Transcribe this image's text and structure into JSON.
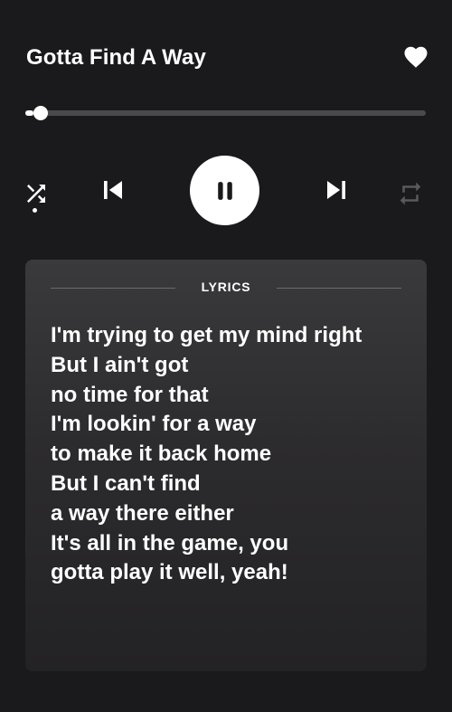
{
  "player": {
    "song_title": "Gotta Find A Way",
    "liked": true,
    "progress_fraction": 0.02,
    "shuffle_on": true,
    "repeat_on": false,
    "state": "playing"
  },
  "icons": {
    "like": "heart-icon",
    "shuffle": "shuffle-icon",
    "previous": "skip-previous-icon",
    "play_pause": "pause-icon",
    "next": "skip-next-icon",
    "repeat": "repeat-icon"
  },
  "colors": {
    "background": "#1a191b",
    "foreground": "#ffffff",
    "inactive": "#4a494c"
  },
  "lyrics": {
    "label": "LYRICS",
    "lines": [
      "I'm trying to get my mind right",
      "But I ain't got",
      "no time for that",
      "I'm lookin' for a way",
      "to make it back home",
      "But I can't find",
      "a way there either",
      "It's all in the game, you",
      "gotta play it well, yeah!"
    ]
  }
}
